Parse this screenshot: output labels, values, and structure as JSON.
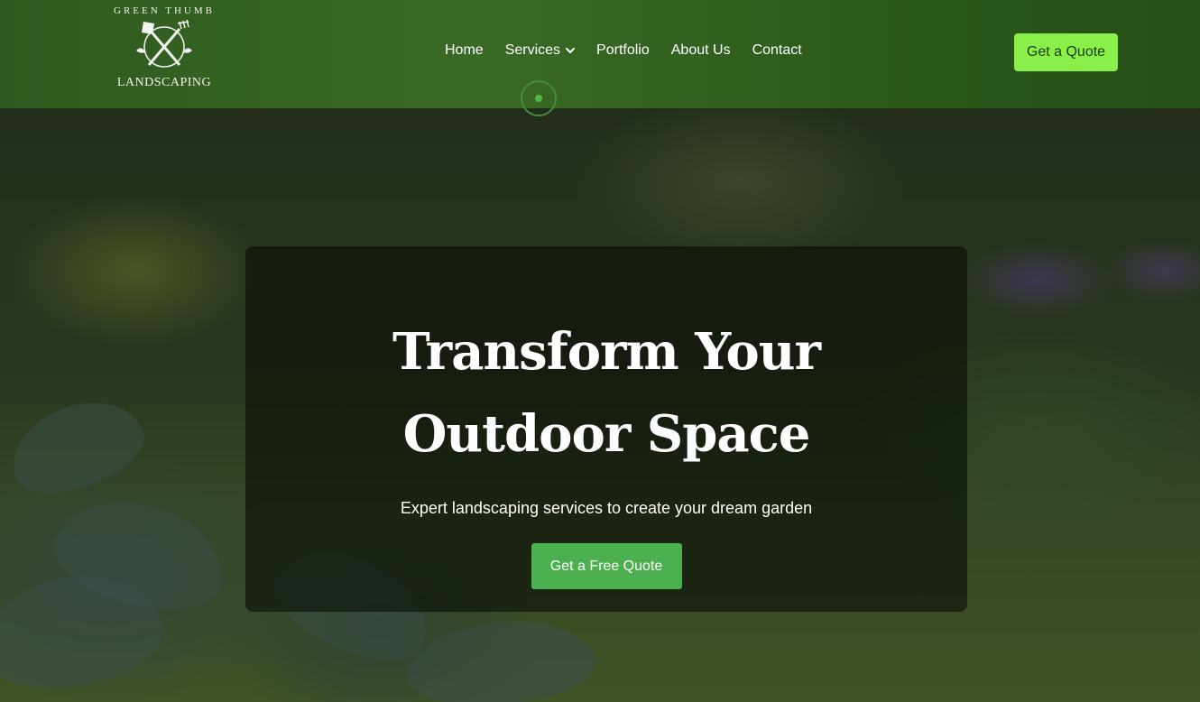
{
  "logo": {
    "top_text": "GREEN THUMB",
    "bottom_text": "LANDSCAPING",
    "icon": "crossed-shovel-rake-icon"
  },
  "nav": {
    "items": [
      {
        "label": "Home"
      },
      {
        "label": "Services",
        "icon": "chevron-down-icon"
      },
      {
        "label": "Portfolio"
      },
      {
        "label": "About Us"
      },
      {
        "label": "Contact"
      }
    ]
  },
  "header": {
    "quote_label": "Get a Quote",
    "accent_color": "#8bef4a"
  },
  "hero": {
    "title": "Transform Your Outdoor Space",
    "subtitle": "Expert landscaping services to create your dream garden",
    "cta_label": "Get a Free Quote",
    "cta_color": "#4caf50"
  }
}
